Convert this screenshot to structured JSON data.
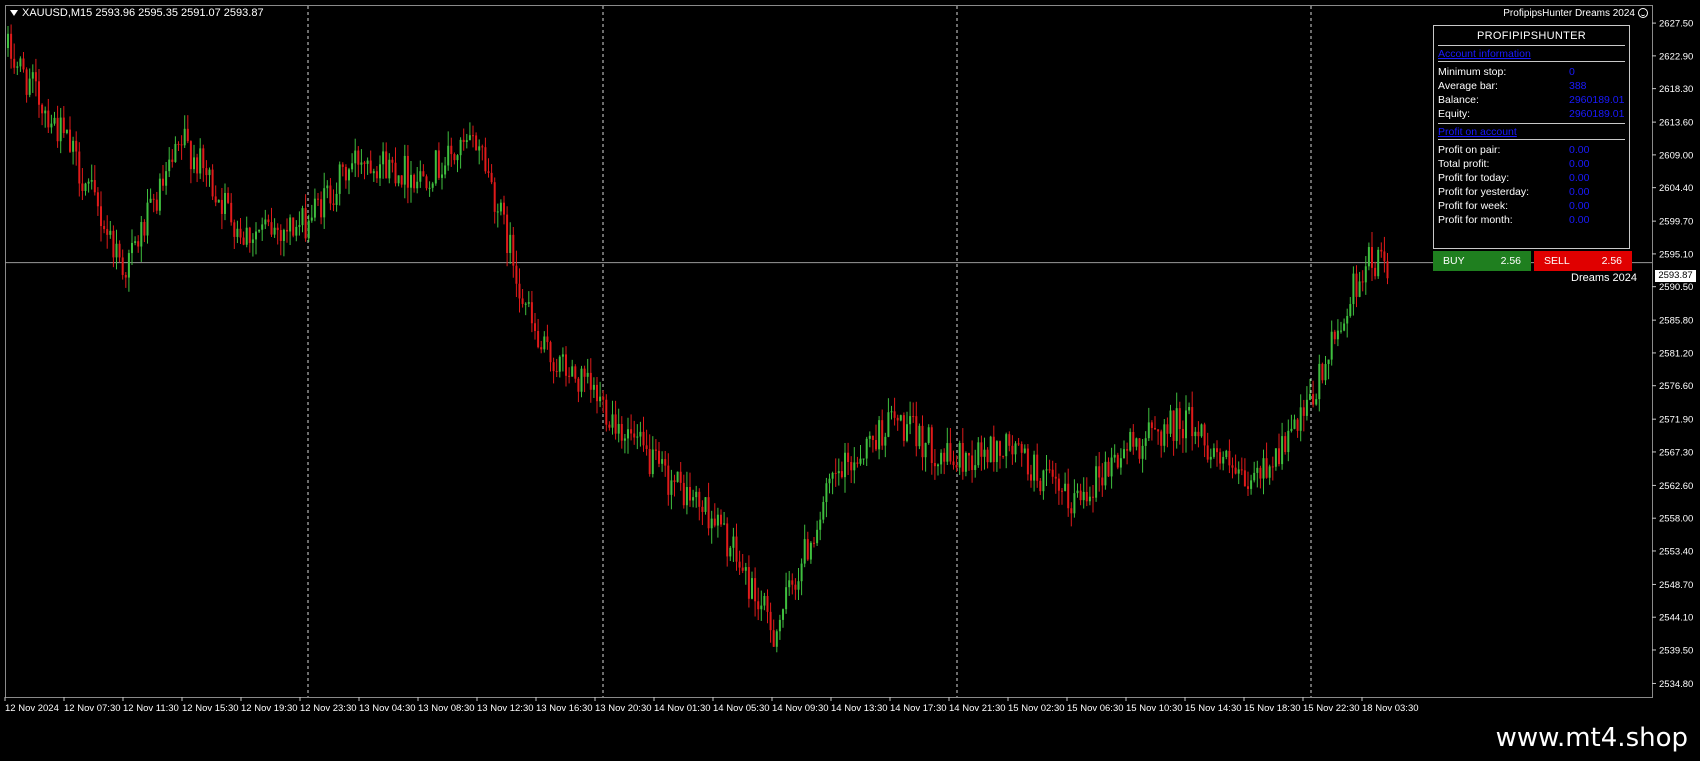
{
  "header": {
    "symbol_info": "XAUUSD,M15  2593.96 2595.35 2591.07 2593.87",
    "brand": "ProfipipsHunter Dreams 2024"
  },
  "panel": {
    "title": "PROFIPIPSHUNTER",
    "account_section": "Account information",
    "profit_section": "Profit on account",
    "account_rows": [
      {
        "label": "Minimum stop:",
        "value": "0"
      },
      {
        "label": "Average bar:",
        "value": "388"
      },
      {
        "label": "Balance:",
        "value": "2960189.01"
      },
      {
        "label": "Equity:",
        "value": "2960189.01"
      }
    ],
    "profit_rows": [
      {
        "label": "Profit on pair:",
        "value": "0.00"
      },
      {
        "label": "Total profit:",
        "value": "0.00"
      },
      {
        "label": "Profit for today:",
        "value": "0.00"
      },
      {
        "label": "Profit for yesterday:",
        "value": "0.00"
      },
      {
        "label": "Profit for week:",
        "value": "0.00"
      },
      {
        "label": "Profit for month:",
        "value": "0.00"
      }
    ],
    "buy": {
      "label": "BUY",
      "value": "2.56"
    },
    "sell": {
      "label": "SELL",
      "value": "2.56"
    }
  },
  "dreams_label": "Dreams 2024",
  "current_price": "2593.87",
  "footer": "www.mt4.shop",
  "colors": {
    "up": "#3fbf3f",
    "down": "#e01a1a",
    "background": "#000000",
    "grid": "#c8c8c8"
  },
  "chart_data": {
    "type": "candlestick",
    "symbol": "XAUUSD",
    "timeframe": "M15",
    "ylim": [
      2532.9,
      2629.9
    ],
    "y_ticks": [
      "2627.50",
      "2622.90",
      "2618.30",
      "2613.60",
      "2609.00",
      "2604.40",
      "2599.70",
      "2595.10",
      "2590.50",
      "2585.80",
      "2581.20",
      "2576.60",
      "2571.90",
      "2567.30",
      "2562.60",
      "2558.00",
      "2553.40",
      "2548.70",
      "2544.10",
      "2539.50",
      "2534.80"
    ],
    "x_ticks": [
      "12 Nov 2024",
      "12 Nov 07:30",
      "12 Nov 11:30",
      "12 Nov 15:30",
      "12 Nov 19:30",
      "12 Nov 23:30",
      "13 Nov 04:30",
      "13 Nov 08:30",
      "13 Nov 12:30",
      "13 Nov 16:30",
      "13 Nov 20:30",
      "14 Nov 01:30",
      "14 Nov 05:30",
      "14 Nov 09:30",
      "14 Nov 13:30",
      "14 Nov 17:30",
      "14 Nov 21:30",
      "15 Nov 02:30",
      "15 Nov 06:30",
      "15 Nov 10:30",
      "15 Nov 14:30",
      "15 Nov 18:30",
      "15 Nov 22:30",
      "18 Nov 03:30"
    ],
    "current_price": 2593.87,
    "session_separators": [
      "12 Nov 23:30",
      "13 Nov 20:30",
      "14 Nov 21:30",
      "15 Nov 22:30"
    ],
    "close_path": [
      {
        "x": "12 Nov 2024",
        "y": 2624.0
      },
      {
        "x": "12 Nov 07:30",
        "y": 2611.0
      },
      {
        "x": "12 Nov 11:30",
        "y": 2593.0
      },
      {
        "x": "12 Nov 15:30",
        "y": 2611.0
      },
      {
        "x": "12 Nov 19:30",
        "y": 2598.0
      },
      {
        "x": "12 Nov 23:30",
        "y": 2599.0
      },
      {
        "x": "13 Nov 04:30",
        "y": 2609.0
      },
      {
        "x": "13 Nov 08:30",
        "y": 2606.0
      },
      {
        "x": "13 Nov 12:30",
        "y": 2611.0
      },
      {
        "x": "13 Nov 16:30",
        "y": 2582.0
      },
      {
        "x": "13 Nov 20:30",
        "y": 2575.0
      },
      {
        "x": "14 Nov 01:30",
        "y": 2565.0
      },
      {
        "x": "14 Nov 05:30",
        "y": 2558.0
      },
      {
        "x": "14 Nov 09:30",
        "y": 2542.0
      },
      {
        "x": "14 Nov 13:30",
        "y": 2563.0
      },
      {
        "x": "14 Nov 17:30",
        "y": 2572.0
      },
      {
        "x": "14 Nov 21:30",
        "y": 2566.0
      },
      {
        "x": "15 Nov 02:30",
        "y": 2568.0
      },
      {
        "x": "15 Nov 06:30",
        "y": 2560.0
      },
      {
        "x": "15 Nov 10:30",
        "y": 2568.0
      },
      {
        "x": "15 Nov 14:30",
        "y": 2572.0
      },
      {
        "x": "15 Nov 18:30",
        "y": 2562.0
      },
      {
        "x": "15 Nov 22:30",
        "y": 2572.0
      },
      {
        "x": "18 Nov 03:30",
        "y": 2593.87
      }
    ]
  }
}
